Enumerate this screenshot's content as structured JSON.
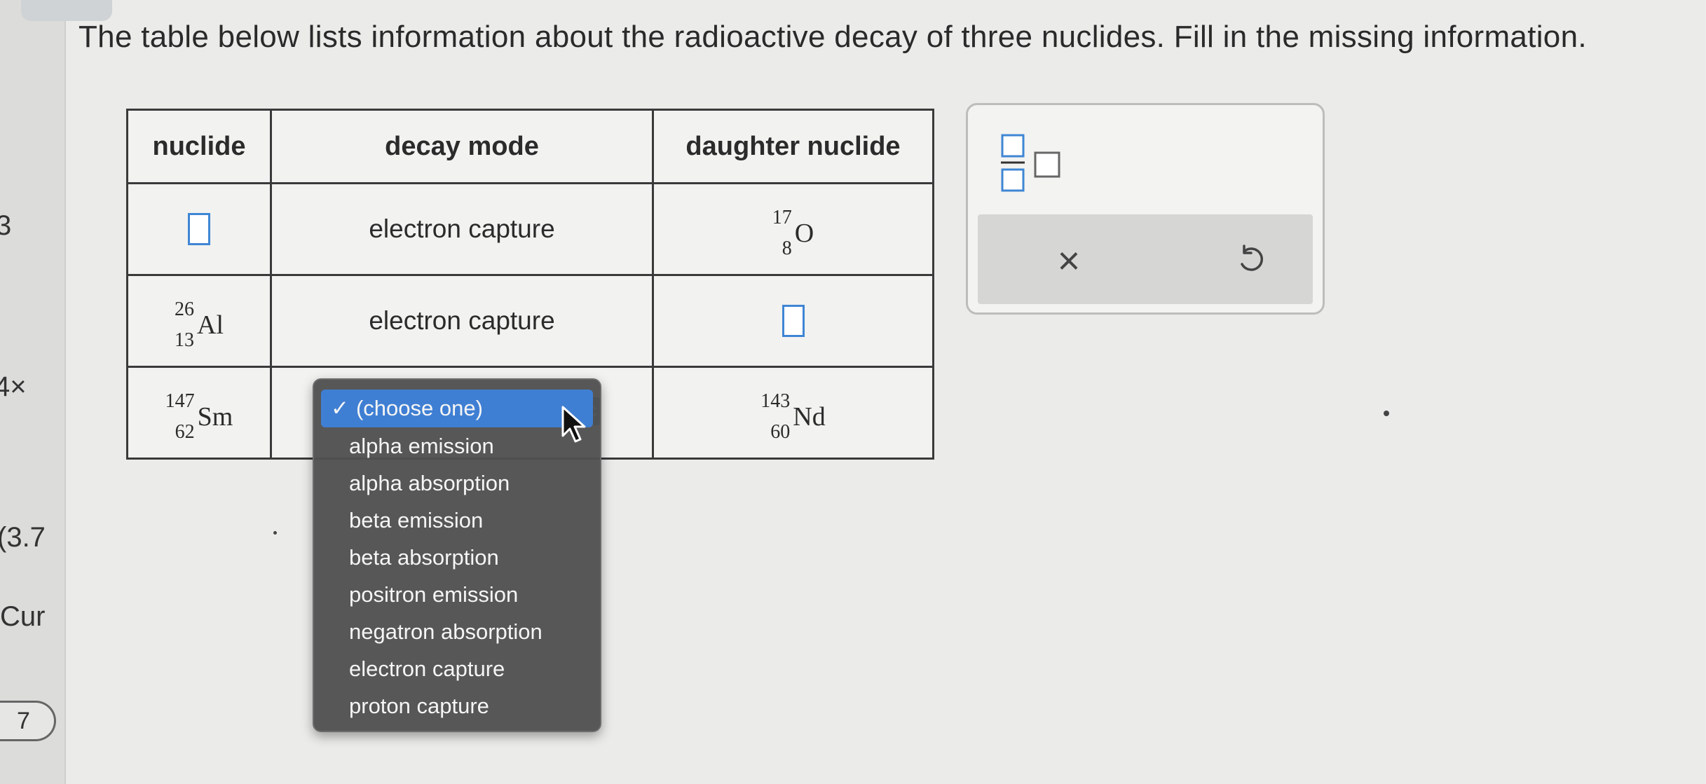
{
  "question": "The table below lists information about the radioactive decay of three nuclides. Fill in the missing information.",
  "left_strip": {
    "t1": "3",
    "t2": "4×",
    "t3": "(3.7",
    "t4": "Cur",
    "t5": "7"
  },
  "table": {
    "headers": [
      "nuclide",
      "decay mode",
      "daughter nuclide"
    ],
    "row1": {
      "decay_mode": "electron capture",
      "daughter": {
        "mass": "17",
        "atomic": "8",
        "symbol": "O"
      }
    },
    "row2": {
      "nuclide": {
        "mass": "26",
        "atomic": "13",
        "symbol": "Al"
      },
      "decay_mode": "electron capture"
    },
    "row3": {
      "nuclide": {
        "mass": "147",
        "atomic": "62",
        "symbol": "Sm"
      },
      "daughter": {
        "mass": "143",
        "atomic": "60",
        "symbol": "Nd"
      }
    }
  },
  "dropdown": {
    "selected": "(choose one)",
    "check": "✓",
    "options": [
      "alpha emission",
      "alpha absorption",
      "beta emission",
      "beta absorption",
      "positron emission",
      "negatron absorption",
      "electron capture",
      "proton capture"
    ]
  },
  "tools": {
    "clear_symbol": "×"
  },
  "colors": {
    "accent": "#3f7fd3",
    "dropdown_bg": "#505050"
  }
}
